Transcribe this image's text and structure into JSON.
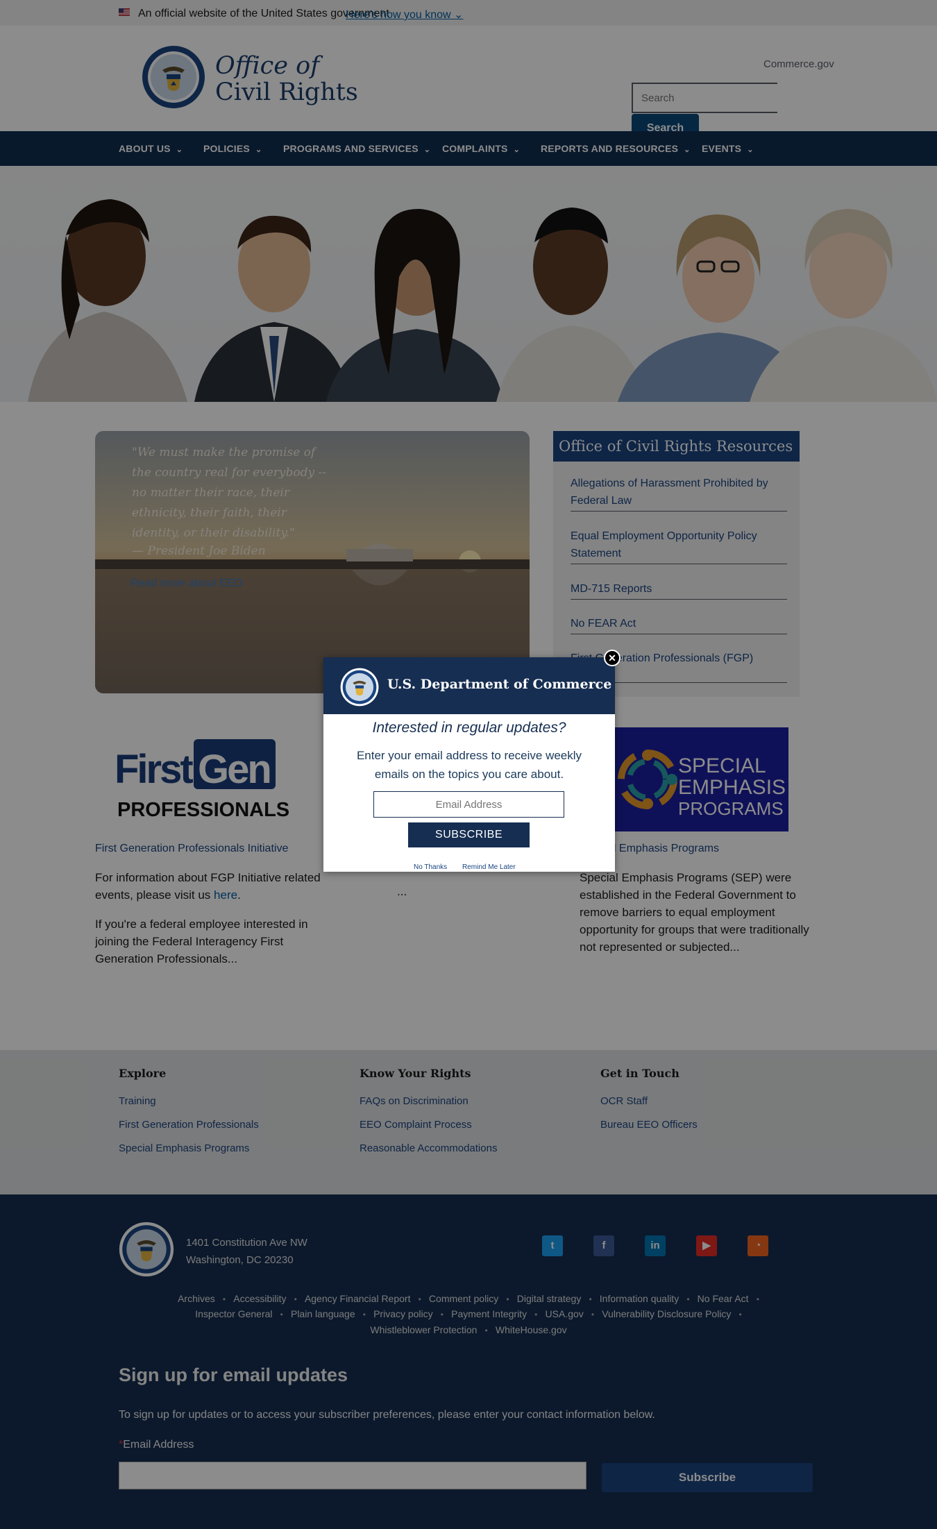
{
  "gov_banner": {
    "text": "An official website of the United States government",
    "link": "Here's how you know"
  },
  "header": {
    "title_line1": "Office of",
    "title_line2": "Civil Rights",
    "commerce_link": "Commerce.gov",
    "search_placeholder": "Search",
    "search_button": "Search"
  },
  "nav": [
    {
      "label": "ABOUT US"
    },
    {
      "label": "POLICIES"
    },
    {
      "label": "PROGRAMS AND SERVICES"
    },
    {
      "label": "COMPLAINTS"
    },
    {
      "label": "REPORTS AND RESOURCES"
    },
    {
      "label": "EVENTS"
    }
  ],
  "quote": {
    "text": "\"We must make the promise of the country real for everybody -- no matter their race, their ethnicity, their faith, their identity, or their disability.\"",
    "author": "— President Joe Biden",
    "link": "Read more about EEO"
  },
  "resources": {
    "heading": "Office of Civil Rights Resources",
    "items": [
      "Allegations of Harassment Prohibited by Federal Law",
      "Equal Employment Opportunity Policy Statement",
      "MD-715 Reports",
      "No FEAR Act",
      "First Generation Professionals (FGP)"
    ]
  },
  "cards": {
    "fgp_logo_line1_a": "First",
    "fgp_logo_line1_b": "Gen",
    "fgp_logo_line2": "PROFESSIONALS",
    "fgp_title": "First Generation Professionals Initiative",
    "fgp_text1_a": "For information about FGP Initiative related events, please visit us ",
    "fgp_text1_link": "here",
    "fgp_text1_b": ".",
    "fgp_text2": "If you're a federal employee interested in joining the Federal Interagency First Generation Professionals...",
    "middle_text": "...",
    "sep_logo_line1": "SPECIAL",
    "sep_logo_line2": "EMPHASIS",
    "sep_logo_line3": "PROGRAMS",
    "sep_title": "Special Emphasis Programs",
    "sep_text": "Special Emphasis Programs (SEP) were established in the Federal Government to remove barriers to equal employment opportunity for groups that were traditionally not represented or subjected..."
  },
  "footer_links": {
    "explore": {
      "heading": "Explore",
      "items": [
        "Training",
        "First Generation Professionals",
        "Special Emphasis Programs"
      ]
    },
    "rights": {
      "heading": "Know Your Rights",
      "items": [
        "FAQs on Discrimination",
        "EEO Complaint Process",
        "Reasonable Accommodations"
      ]
    },
    "contact": {
      "heading": "Get in Touch",
      "items": [
        "OCR Staff",
        "Bureau EEO Officers"
      ]
    }
  },
  "footer": {
    "address_line1": "1401 Constitution Ave NW",
    "address_line2": "Washington, DC 20230",
    "social": [
      {
        "icon": "twitter-icon",
        "glyph": "t",
        "color": "#1da1f2"
      },
      {
        "icon": "facebook-icon",
        "glyph": "f",
        "color": "#3b5998"
      },
      {
        "icon": "linkedin-icon",
        "glyph": "in",
        "color": "#0077b5"
      },
      {
        "icon": "youtube-icon",
        "glyph": "▶",
        "color": "#e52d27"
      },
      {
        "icon": "rss-icon",
        "glyph": "◔",
        "color": "#f26522"
      }
    ],
    "links_row1": [
      "Archives",
      "Accessibility",
      "Agency Financial Report",
      "Comment policy",
      "Digital strategy",
      "Information quality",
      "No Fear Act"
    ],
    "links_row2": [
      "Inspector General",
      "Plain language",
      "Privacy policy",
      "Payment Integrity",
      "USA.gov",
      "Vulnerability Disclosure Policy"
    ],
    "links_row3": [
      "Whistleblower Protection",
      "WhiteHouse.gov"
    ]
  },
  "signup": {
    "title": "Sign up for email updates",
    "description": "To sign up for updates or to access your subscriber preferences, please enter your contact information below.",
    "required_mark": "*",
    "label": "Email Address",
    "button": "Subscribe"
  },
  "modal": {
    "org": "U.S. Department of Commerce",
    "question": "Interested in regular updates?",
    "description": "Enter your email address to receive weekly emails on the topics you care about.",
    "email_placeholder": "Email Address",
    "subscribe": "SUBSCRIBE",
    "no_thanks": "No Thanks",
    "remind": "Remind Me Later"
  },
  "colors": {
    "nav": "#112e51",
    "accent": "#1a4480",
    "footer_light": "#dfe1e2",
    "footer_dark": "#162e51"
  }
}
